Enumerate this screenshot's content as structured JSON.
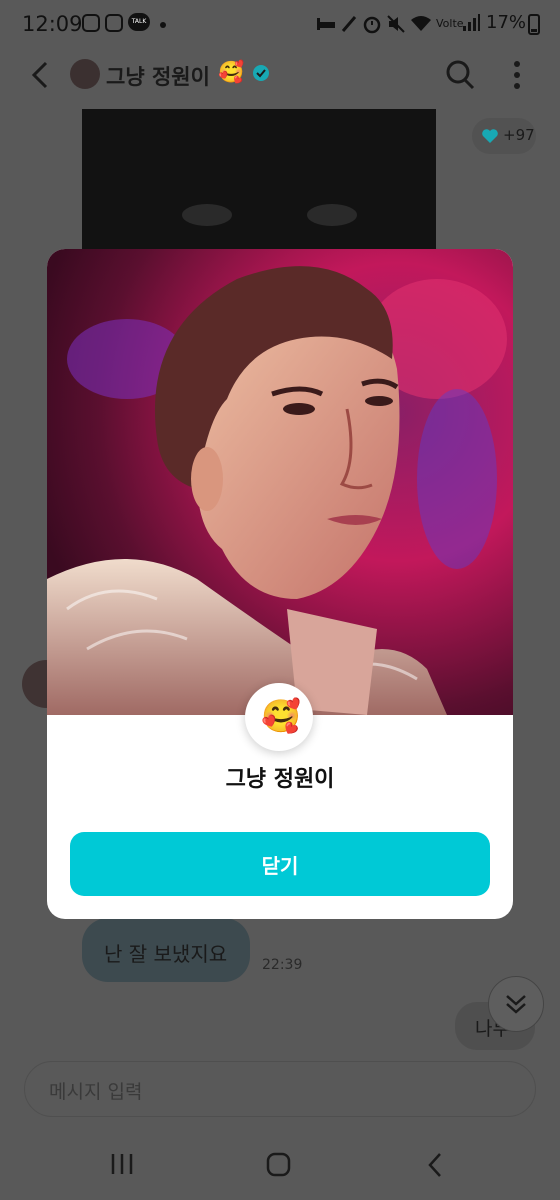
{
  "status_bar": {
    "time": "12:09",
    "talk_badge": "TALK",
    "network_label": "Volte",
    "battery": "17%"
  },
  "app_bar": {
    "title": "그냥 정원이",
    "title_emoji": "🥰",
    "icons": [
      "back-arrow-icon",
      "avatar",
      "verified-badge-icon",
      "search-icon",
      "more-vertical-icon"
    ]
  },
  "chat": {
    "reaction_count": "+97",
    "messages": [
      {
        "text": "난 잘 보냈지요",
        "time": "22:39"
      },
      {
        "text": "나두"
      }
    ],
    "input_placeholder": "메시지 입력"
  },
  "modal": {
    "emoji": "🥰",
    "name": "그냥 정원이",
    "close_label": "닫기",
    "accent_color": "#00c9d6"
  },
  "colors": {
    "dim_overlay": "#595959",
    "verified": "#18a9b4"
  }
}
